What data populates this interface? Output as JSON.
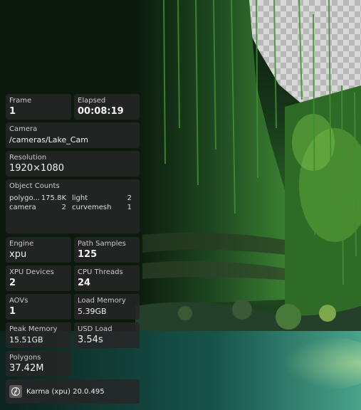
{
  "overlay": {
    "frame": {
      "label": "Frame",
      "value": "1"
    },
    "elapsed": {
      "label": "Elapsed",
      "value": "00:08:19"
    },
    "camera": {
      "label": "Camera",
      "value": "/cameras/Lake_Cam"
    },
    "resolution": {
      "label": "Resolution",
      "value": "1920×1080"
    },
    "object_counts": {
      "label": "Object Counts",
      "items": [
        {
          "name": "polygo...",
          "value": "175.8K"
        },
        {
          "name": "light",
          "value": "2"
        },
        {
          "name": "camera",
          "value": "2"
        },
        {
          "name": "curvemesh",
          "value": "1"
        }
      ]
    },
    "engine": {
      "label": "Engine",
      "value": "xpu"
    },
    "path_samples": {
      "label": "Path Samples",
      "value": "125"
    },
    "xpu_devices": {
      "label": "XPU Devices",
      "value": "2"
    },
    "cpu_threads": {
      "label": "CPU Threads",
      "value": "24"
    },
    "aovs": {
      "label": "AOVs",
      "value": "1"
    },
    "load_memory": {
      "label": "Load Memory",
      "value": "5.39GB"
    },
    "peak_memory": {
      "label": "Peak Memory",
      "value": "15.51GB"
    },
    "usd_load": {
      "label": "USD Load",
      "value": "3.54s"
    },
    "polygons": {
      "label": "Polygons",
      "value": "37.42M"
    },
    "renderer": {
      "icon": "karma-logo-icon",
      "text": "Karma (xpu) 20.0.495"
    }
  },
  "colors": {
    "panel_bg": "#262626",
    "label_text": "#c9c9c9",
    "value_text": "#f2f2f2"
  }
}
